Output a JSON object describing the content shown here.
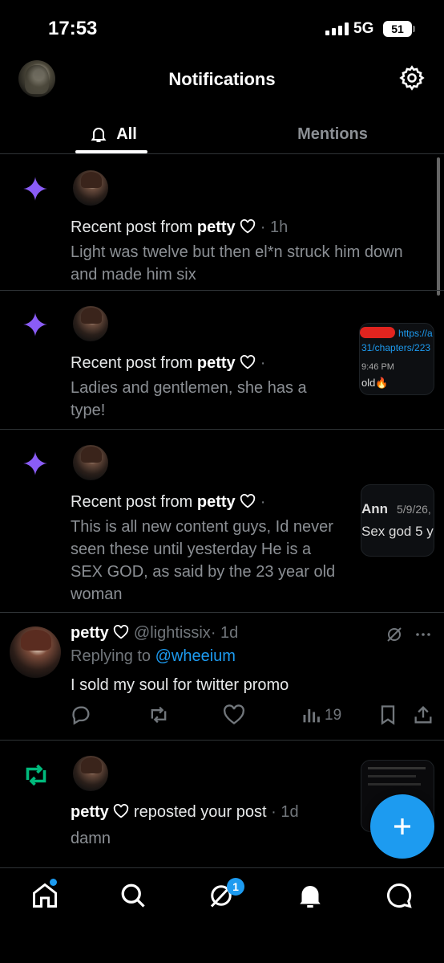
{
  "status_bar": {
    "time": "17:53",
    "network": "5G",
    "battery": "51"
  },
  "header": {
    "title": "Notifications"
  },
  "tabs": [
    {
      "label": "All"
    },
    {
      "label": "Mentions"
    }
  ],
  "notifications": [
    {
      "prefix": "Recent post from",
      "author": "petty",
      "time": "· 1h",
      "text": "Light was twelve but then el*n struck him down and made him six"
    },
    {
      "prefix": "Recent post from",
      "author": "petty",
      "time": "·",
      "text": "Ladies and gentlemen, she has a type!",
      "thumb": {
        "url": "https://a",
        "path": "31/chapters/223",
        "time": "9:46 PM",
        "snippet": "old🔥"
      }
    },
    {
      "prefix": "Recent post from",
      "author": "petty",
      "time": "·",
      "text": "This is all new content guys, Id never seen these until yesterday He is a SEX GOD, as said by the 23 year old woman",
      "thumb": {
        "name": "Ann",
        "date": "5/9/26,",
        "snippet": "Sex god 5 y"
      }
    }
  ],
  "tweet": {
    "display_name": "petty",
    "handle": "@lightissix",
    "time": "· 1d",
    "reply_prefix": "Replying to",
    "reply_to": "@wheeium",
    "text": "I sold my soul for twitter promo",
    "views": "19"
  },
  "repost": {
    "author": "petty",
    "action": "reposted your post",
    "time": "· 1d",
    "text": "damn"
  },
  "bottom_nav": {
    "messages_badge": "1"
  },
  "colors": {
    "accent": "#1d9bf0",
    "sparkle": "#8a5cf6",
    "repost": "#00ba7c"
  }
}
